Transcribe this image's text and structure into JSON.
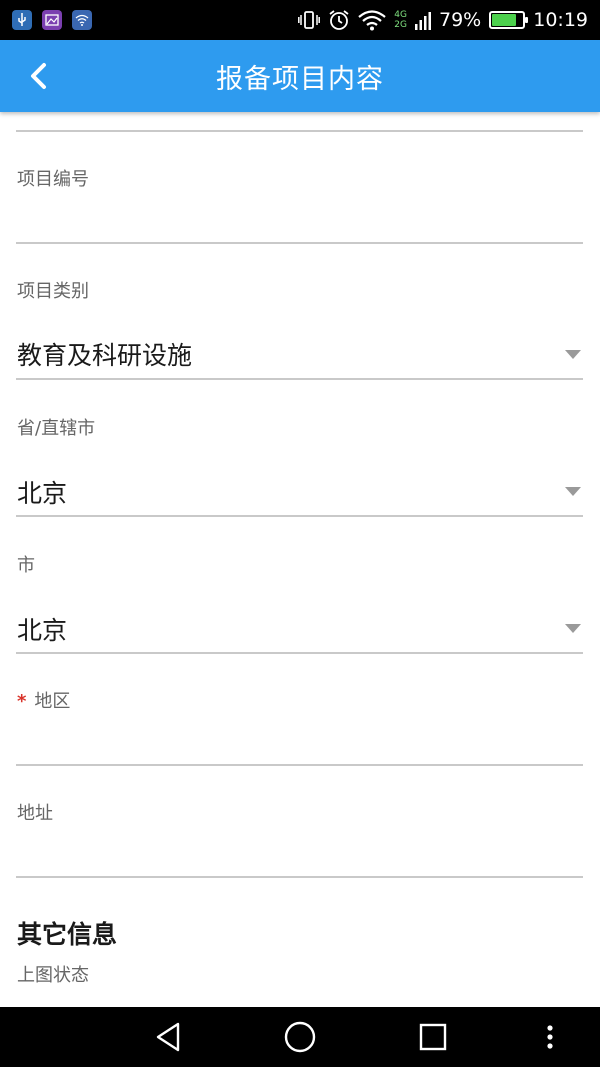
{
  "status_bar": {
    "battery_percent": "79%",
    "time": "10:19",
    "network_top": "4G",
    "network_bottom": "2G",
    "battery_level": 0.79,
    "icons": [
      "usb-icon",
      "image-icon",
      "wifi-notification-icon",
      "vibrate-icon",
      "alarm-icon",
      "wifi-signal-icon",
      "cell-signal-icon",
      "battery-charging-icon"
    ]
  },
  "app_bar": {
    "title": "报备项目内容",
    "back_icon": "chevron-left-icon"
  },
  "form": {
    "project_number": {
      "label": "项目编号",
      "value": ""
    },
    "project_category": {
      "label": "项目类别",
      "value": "教育及科研设施"
    },
    "province": {
      "label": "省/直辖市",
      "value": "北京"
    },
    "city": {
      "label": "市",
      "value": "北京"
    },
    "district": {
      "required_mark": "*",
      "label": "地区",
      "value": ""
    },
    "address": {
      "label": "地址",
      "value": ""
    }
  },
  "other_section": {
    "title": "其它信息",
    "map_status_label": "上图状态"
  },
  "colors": {
    "app_bar": "#2e9bef",
    "required": "#d9342b",
    "divider": "#c9c9c9"
  },
  "nav_bar": {
    "icons": [
      "back-triangle-icon",
      "home-circle-icon",
      "recents-square-icon",
      "more-dots-icon"
    ]
  }
}
